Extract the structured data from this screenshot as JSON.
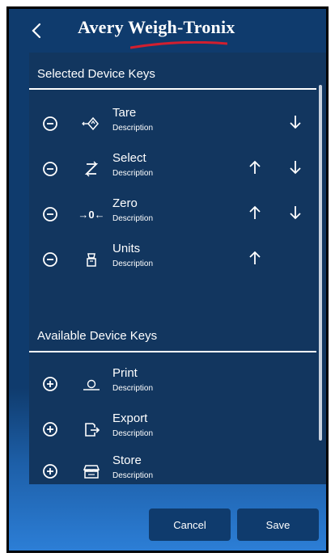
{
  "header": {
    "back_icon": "chevron-left-icon",
    "logo_text": "Avery Weigh-Tronix"
  },
  "selected": {
    "title": "Selected Device Keys",
    "items": [
      {
        "name": "Tare",
        "description": "Description",
        "icon": "tare-icon",
        "up": false,
        "down": true
      },
      {
        "name": "Select",
        "description": "Description",
        "icon": "select-icon",
        "up": true,
        "down": true
      },
      {
        "name": "Zero",
        "description": "Description",
        "icon": "zero-icon",
        "icon_text": "→0←",
        "up": true,
        "down": true
      },
      {
        "name": "Units",
        "description": "Description",
        "icon": "units-icon",
        "up": true,
        "down": false
      }
    ]
  },
  "available": {
    "title": "Available Device Keys",
    "items": [
      {
        "name": "Print",
        "description": "Description",
        "icon": "print-icon"
      },
      {
        "name": "Export",
        "description": "Description",
        "icon": "export-icon"
      },
      {
        "name": "Store",
        "description": "Description",
        "icon": "store-icon"
      }
    ]
  },
  "footer": {
    "cancel_label": "Cancel",
    "save_label": "Save"
  },
  "colors": {
    "header_bg": "#0f3b6d",
    "panel_bg": "#12365f",
    "logo_swoosh": "#d11f2f"
  }
}
